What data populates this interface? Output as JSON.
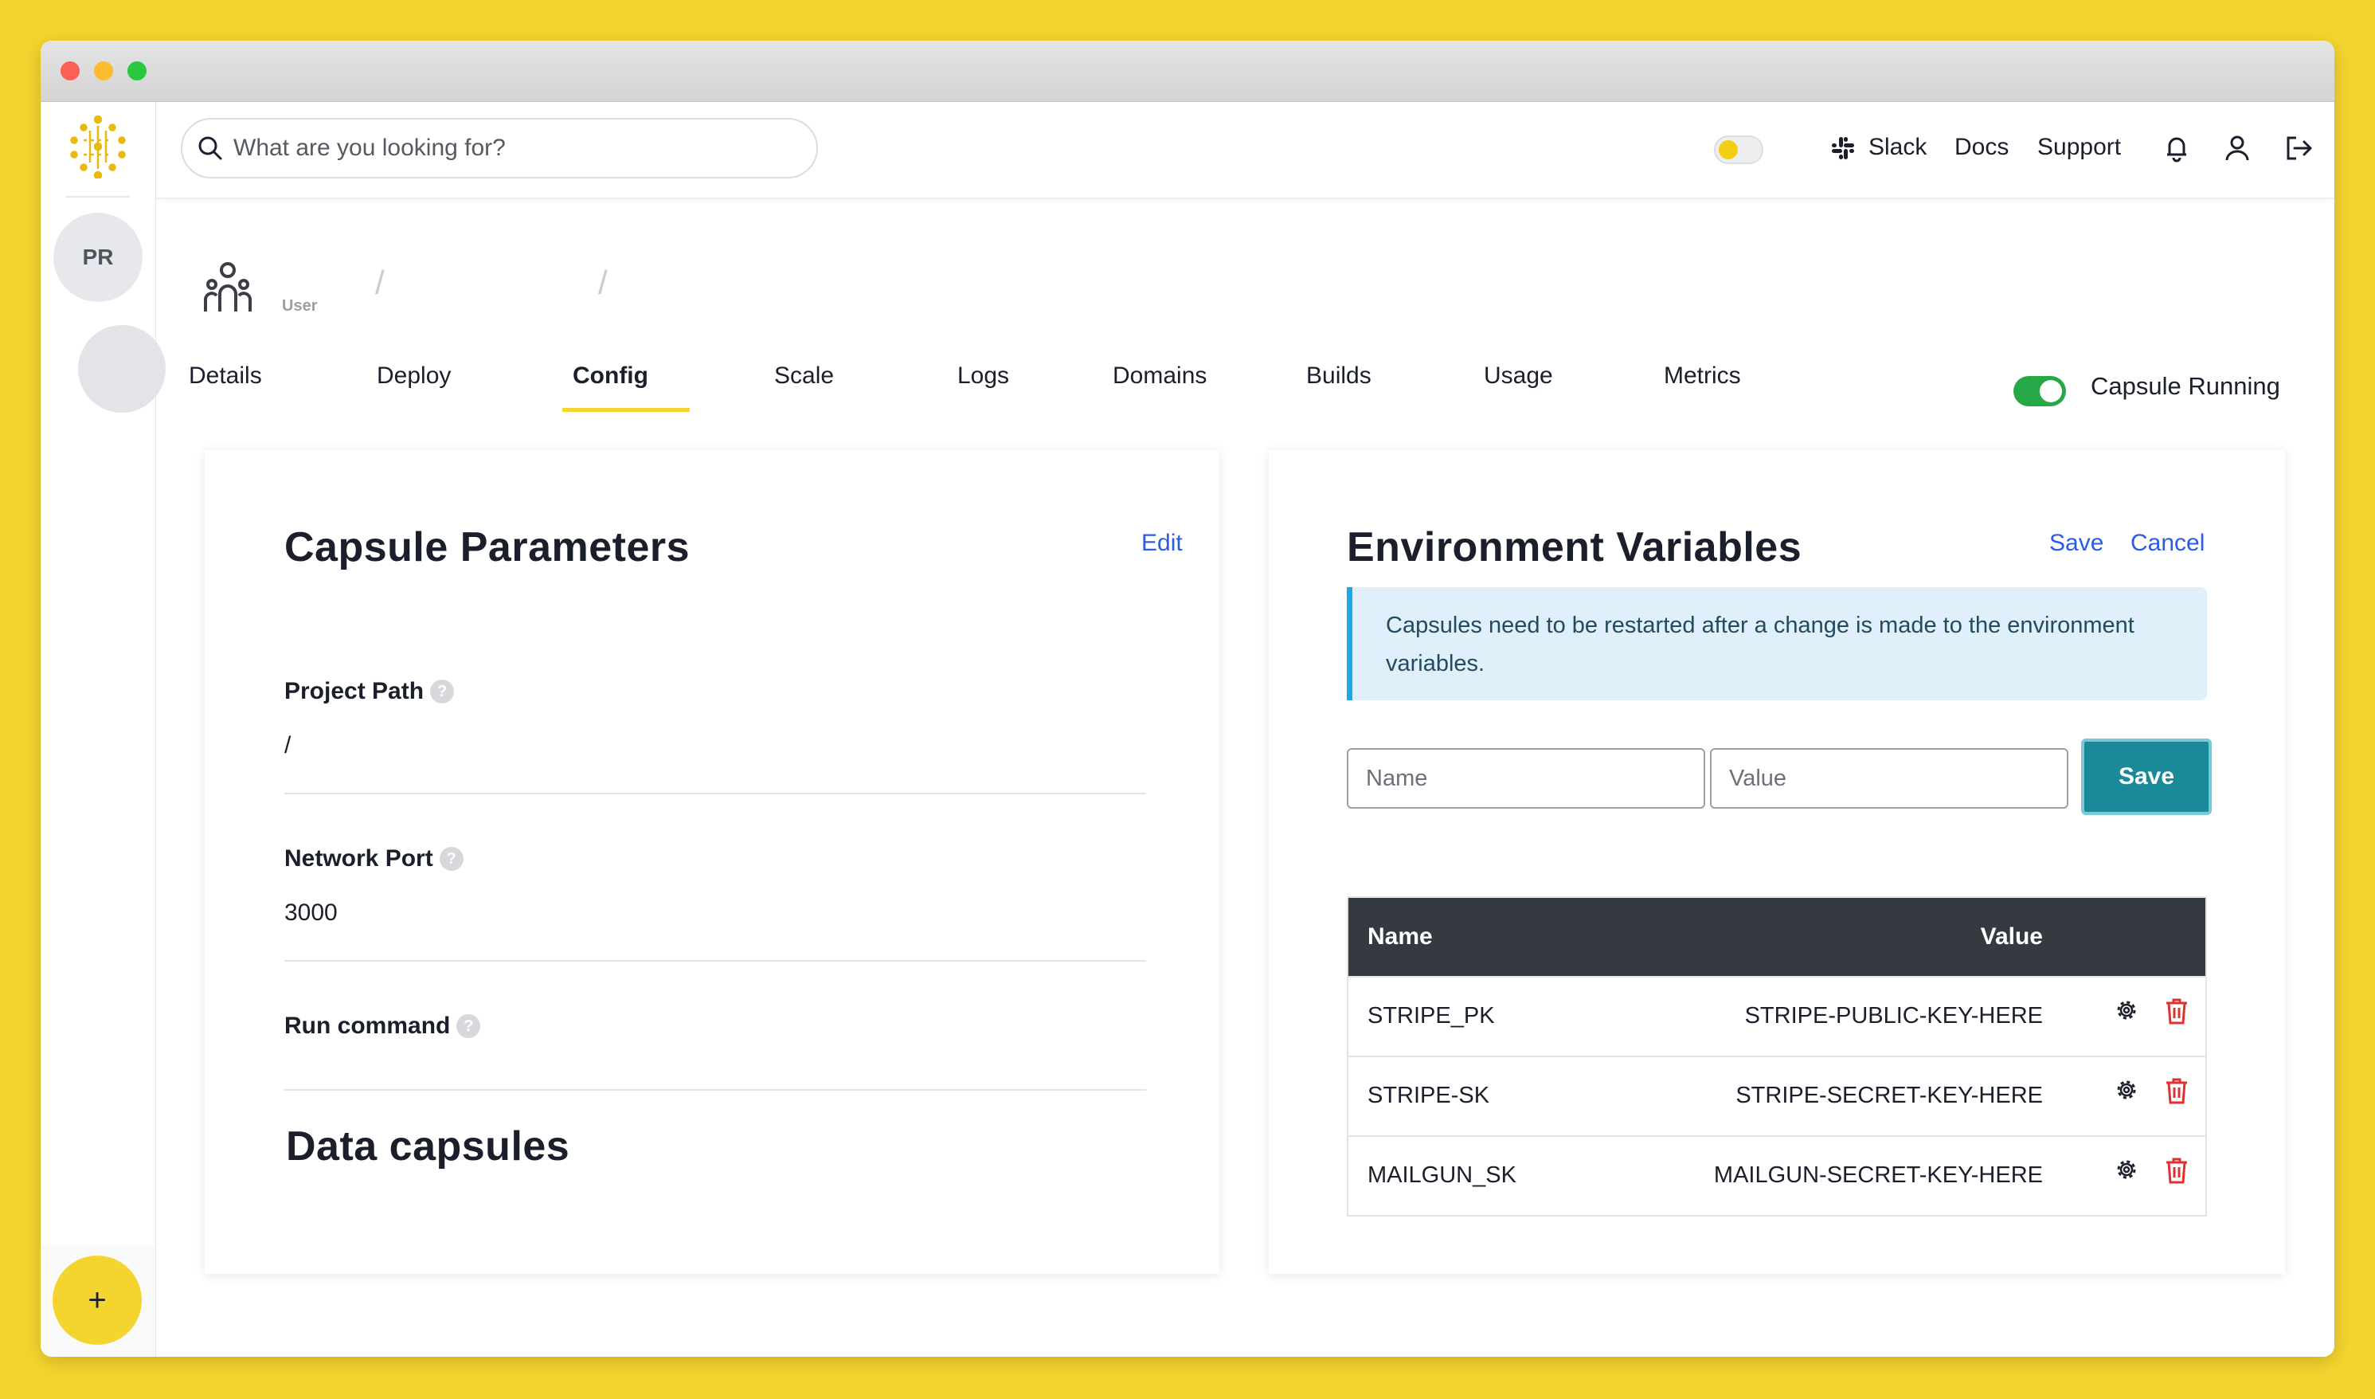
{
  "search": {
    "placeholder": "What are you looking for?"
  },
  "topbar": {
    "links": {
      "slack": "Slack",
      "docs": "Docs",
      "support": "Support"
    },
    "icons": [
      "sun-toggle",
      "slack-icon",
      "bell-icon",
      "user-icon",
      "logout-icon"
    ]
  },
  "sidebar": {
    "avatar_initials": "PR",
    "add_button": "+"
  },
  "breadcrumb": {
    "user_label": "User",
    "separator": "/"
  },
  "tabs": [
    {
      "label": "Details"
    },
    {
      "label": "Deploy"
    },
    {
      "label": "Config",
      "active": true
    },
    {
      "label": "Scale"
    },
    {
      "label": "Logs"
    },
    {
      "label": "Domains"
    },
    {
      "label": "Builds"
    },
    {
      "label": "Usage"
    },
    {
      "label": "Metrics"
    }
  ],
  "status": {
    "label": "Capsule Running",
    "on": true
  },
  "capsule_params": {
    "title": "Capsule Parameters",
    "edit_label": "Edit",
    "fields": [
      {
        "label": "Project Path",
        "value": "/"
      },
      {
        "label": "Network Port",
        "value": "3000"
      },
      {
        "label": "Run command",
        "value": ""
      }
    ],
    "data_title": "Data capsules"
  },
  "env_vars": {
    "title": "Environment Variables",
    "save_label": "Save",
    "cancel_label": "Cancel",
    "alert": "Capsules need to be restarted after a change is made to the environment variables.",
    "name_placeholder": "Name",
    "value_placeholder": "Value",
    "add_button": "Save",
    "columns": {
      "name": "Name",
      "value": "Value"
    },
    "rows": [
      {
        "name": "STRIPE_PK",
        "value": "STRIPE-PUBLIC-KEY-HERE"
      },
      {
        "name": "STRIPE-SK",
        "value": "STRIPE-SECRET-KEY-HERE"
      },
      {
        "name": "MAILGUN_SK",
        "value": "MAILGUN-SECRET-KEY-HERE"
      }
    ]
  },
  "colors": {
    "background": "#f4d52f",
    "accent_yellow": "#f4d52f",
    "link_blue": "#2b5ce6",
    "save_teal": "#1a8a9a",
    "running_green": "#27a745",
    "delete_red": "#e03131",
    "table_header": "#343a40"
  }
}
